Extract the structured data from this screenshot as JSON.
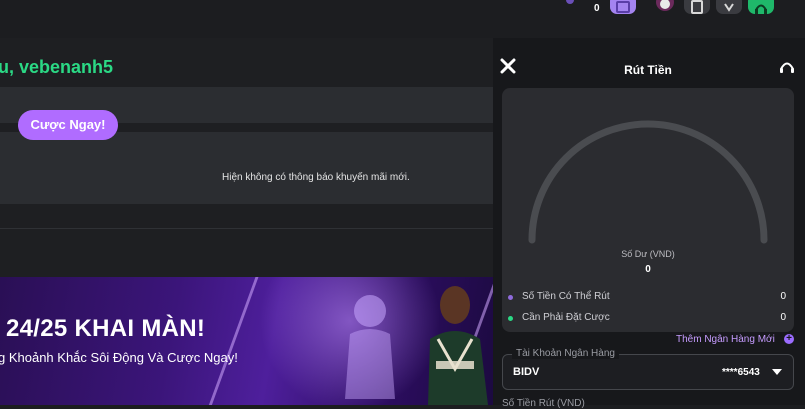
{
  "header": {
    "count": "0",
    "colors": {
      "wallet": "#a484f0",
      "dark_btn": "#3a3b40",
      "green_btn": "#1fb86a"
    }
  },
  "main": {
    "greeting": "u, vebenanh5",
    "promo_empty": "Hiện không có thông báo khuyến mãi mới.",
    "banner": {
      "title": "24/25 KHAI MÀN!",
      "subtitle": "g Khoảnh Khắc Sôi Động Và Cược Ngay!",
      "cta": "Cược Ngay!"
    }
  },
  "panel": {
    "title": "Rút Tiền",
    "gauge": {
      "label": "Số Dư (VND)",
      "value": "0",
      "fill": 0
    },
    "stats": [
      {
        "label": "Số Tiền Có Thể Rút",
        "value": "0",
        "color": "#8f6bdc"
      },
      {
        "label": "Cần Phải Đặt Cược",
        "value": "0",
        "color": "#2bd985"
      }
    ],
    "add_bank": "Thêm Ngân Hàng Mới",
    "bank": {
      "legend": "Tài Khoản Ngân Hàng",
      "name": "BIDV",
      "account": "****6543"
    },
    "amount_label": "Số Tiền Rút (VND)"
  }
}
